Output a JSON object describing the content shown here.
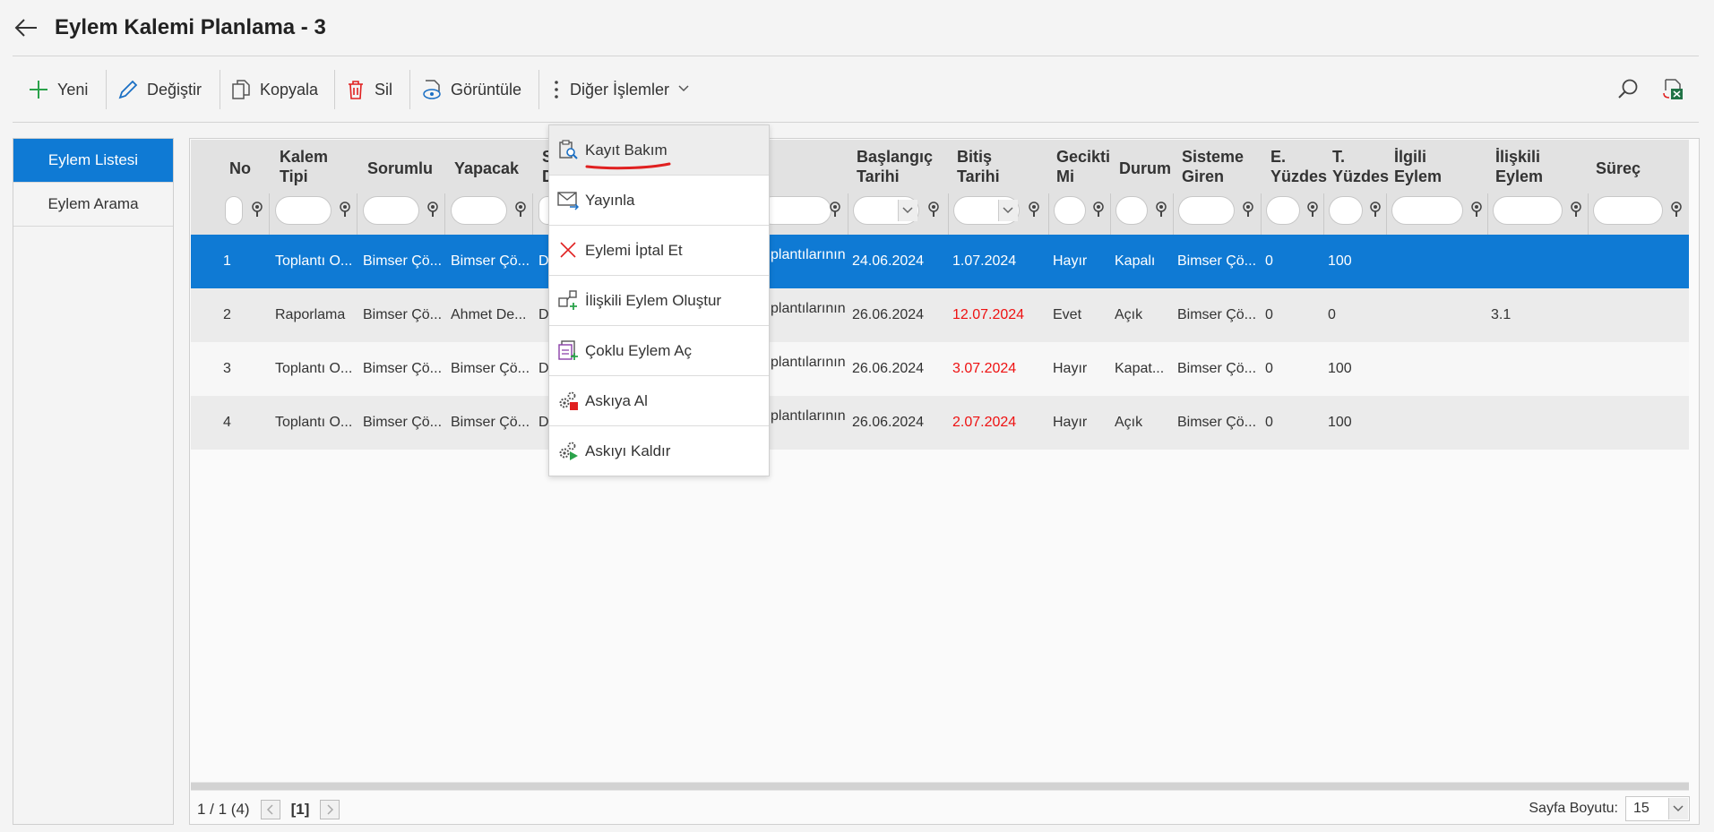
{
  "header": {
    "title": "Eylem Kalemi Planlama - 3"
  },
  "toolbar": {
    "new": "Yeni",
    "edit": "Değiştir",
    "copy": "Kopyala",
    "delete": "Sil",
    "view": "Görüntüle",
    "other": "Diğer İşlemler"
  },
  "left_panel": {
    "items": [
      {
        "label": "Eylem Listesi"
      },
      {
        "label": "Eylem Arama"
      }
    ]
  },
  "grid": {
    "columns": {
      "no": "No",
      "kalem_tipi_1": "Kalem",
      "kalem_tipi_2": "Tipi",
      "sorumlu": "Sorumlu",
      "yapacak": "Yapacak",
      "s_d_1": "S",
      "s_d_2": "D",
      "baslangic_1": "Başlangıç",
      "baslangic_2": "Tarihi",
      "bitis_1": "Bitiş",
      "bitis_2": "Tarihi",
      "gecikti_1": "Gecikti",
      "gecikti_2": "Mi",
      "durum": "Durum",
      "sisteme_1": "Sisteme",
      "sisteme_2": "Giren",
      "e_yuzde_1": "E.",
      "e_yuzde_2": "Yüzdes",
      "t_yuzde_1": "T.",
      "t_yuzde_2": "Yüzdes",
      "ilgili_1": "İlgili",
      "ilgili_2": "Eylem",
      "iliskili_1": "İlişkili",
      "iliskili_2": "Eylem",
      "surec": "Süreç"
    },
    "rows": [
      {
        "no": "1",
        "kalem_tipi": "Toplantı O...",
        "sorumlu": "Bimser Çö...",
        "yapacak": "Bimser Çö...",
        "s": "De",
        "desc": "plantılarının",
        "baslangic": "24.06.2024",
        "bitis": "1.07.2024",
        "gecikti": "Hayır",
        "durum": "Kapalı",
        "sisteme_giren": "Bimser Çö...",
        "e_yuzde": "0",
        "t_yuzde": "100",
        "ilgili": "",
        "iliskili": ""
      },
      {
        "no": "2",
        "kalem_tipi": "Raporlama",
        "sorumlu": "Bimser Çö...",
        "yapacak": "Ahmet De...",
        "s": "De",
        "desc": "plantılarının",
        "baslangic": "26.06.2024",
        "bitis": "12.07.2024",
        "gecikti": "Evet",
        "durum": "Açık",
        "sisteme_giren": "Bimser Çö...",
        "e_yuzde": "0",
        "t_yuzde": "0",
        "ilgili": "",
        "iliskili": "3.1"
      },
      {
        "no": "3",
        "kalem_tipi": "Toplantı O...",
        "sorumlu": "Bimser Çö...",
        "yapacak": "Bimser Çö...",
        "s": "De",
        "desc": "plantılarının",
        "baslangic": "26.06.2024",
        "bitis": "3.07.2024",
        "gecikti": "Hayır",
        "durum": "Kapat...",
        "sisteme_giren": "Bimser Çö...",
        "e_yuzde": "0",
        "t_yuzde": "100",
        "ilgili": "",
        "iliskili": ""
      },
      {
        "no": "4",
        "kalem_tipi": "Toplantı O...",
        "sorumlu": "Bimser Çö...",
        "yapacak": "Bimser Çö...",
        "s": "De",
        "desc": "plantılarının",
        "baslangic": "26.06.2024",
        "bitis": "2.07.2024",
        "gecikti": "Hayır",
        "durum": "Açık",
        "sisteme_giren": "Bimser Çö...",
        "e_yuzde": "0",
        "t_yuzde": "100",
        "ilgili": "",
        "iliskili": ""
      }
    ]
  },
  "pager": {
    "summary": "1 / 1 (4)",
    "current": "[1]",
    "page_size_label": "Sayfa Boyutu:",
    "page_size": "15"
  },
  "context_menu": {
    "items": [
      {
        "label": "Kayıt Bakım"
      },
      {
        "label": "Yayınla"
      },
      {
        "label": "Eylemi İptal Et"
      },
      {
        "label": "İlişkili Eylem Oluştur"
      },
      {
        "label": "Çoklu Eylem Aç"
      },
      {
        "label": "Askıya Al"
      },
      {
        "label": "Askıyı Kaldır"
      }
    ]
  },
  "colors": {
    "accent": "#0f7ad4",
    "overdue": "#e11111",
    "annotation": "#e02020"
  }
}
